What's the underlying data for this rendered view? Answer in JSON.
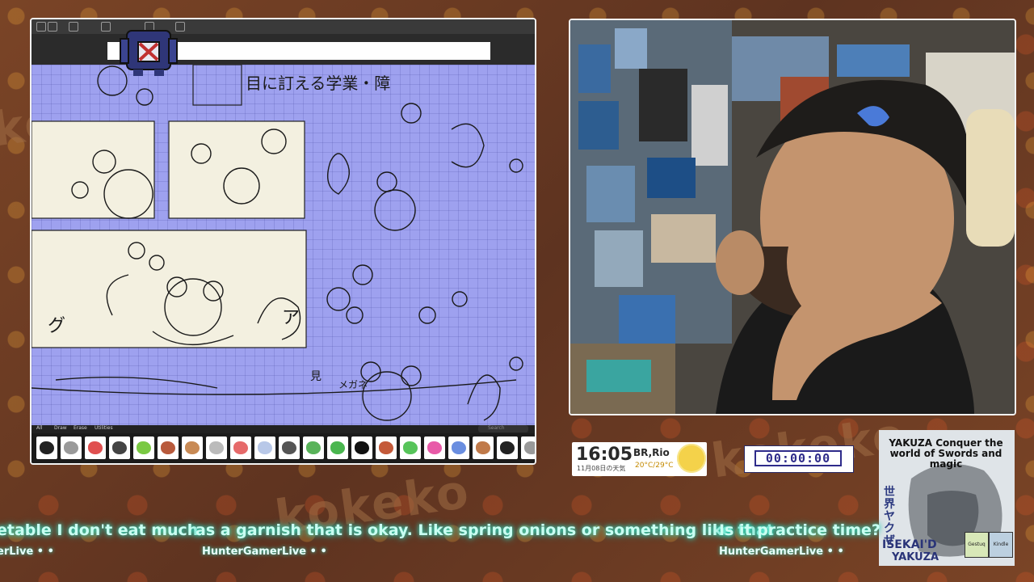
{
  "drawing_app": {
    "brush_tabs": [
      "All",
      "Draw",
      "Erase",
      "Utilities"
    ],
    "search_placeholder": "Search",
    "canvas_text": [
      "目に訂える学業・障",
      "グ",
      "ア",
      "メガネ",
      "見"
    ],
    "brush_colors": [
      "#222222",
      "#9a9a9a",
      "#e05050",
      "#444444",
      "#7ac943",
      "#b85a3c",
      "#c88a55",
      "#bbbbbb",
      "#e66a6a",
      "#b8c8e8",
      "#555555",
      "#59b35a",
      "#4ab64f",
      "#111111",
      "#c45a3a",
      "#57c45a",
      "#e85aa8",
      "#6a8ee0",
      "#c07a4a",
      "#222222",
      "#999999"
    ]
  },
  "clock": {
    "time": "16:05",
    "location": "BR,Rio",
    "date": "11月08日の天気",
    "temp": "20°C/29°C"
  },
  "timer": {
    "value": "00:00:00"
  },
  "book": {
    "title": "YAKUZA Conquer the world of Swords and magic",
    "side_text": "世界ヤクザ",
    "logo_line1": "ISEKAI'D",
    "logo_line2": "YAKUZA",
    "badge1": "Gestuq",
    "badge2": "Kindle"
  },
  "chat": [
    {
      "message": "etable I don't eat much",
      "user": "erLive • •"
    },
    {
      "message": "as a garnish that is okay. Like spring onions or something like that",
      "user": "HunterGamerLive • •"
    },
    {
      "message": "Is it practice time?",
      "user": "HunterGamerLive • •"
    }
  ],
  "background": {
    "watermark": "kokeko"
  }
}
